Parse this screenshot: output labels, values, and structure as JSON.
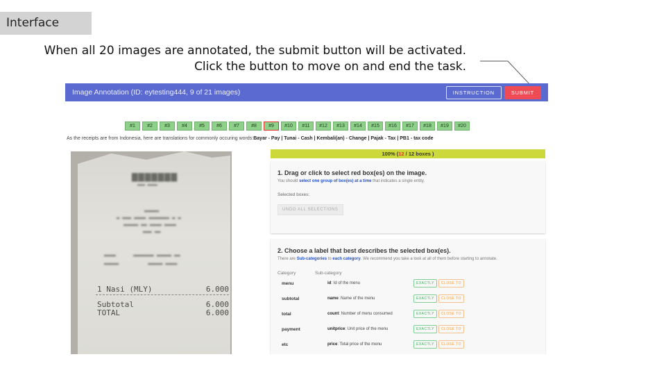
{
  "slide_tag": "Interface",
  "callout": {
    "line1": "When all 20 images are annotated, the submit button will be activated.",
    "line2": "Click the button to move on and end the task."
  },
  "topbar": {
    "title": "Image Annotation (ID: eytesting444, 9 of 21 images)",
    "instruction_label": "INSTRUCTION",
    "submit_label": "SUBMIT"
  },
  "thumbnails": [
    "#1",
    "#2",
    "#3",
    "#4",
    "#5",
    "#6",
    "#7",
    "#8",
    "#9",
    "#10",
    "#11",
    "#12",
    "#13",
    "#14",
    "#15",
    "#16",
    "#17",
    "#18",
    "#19",
    "#20"
  ],
  "active_thumbnail": "#9",
  "translation_note": {
    "prefix": "As the receipts are from Indonesia, here are translations for commonly occuring words:",
    "words": "Bayar - Pay | Tunai - Cash | Kembali(an) - Change | Pajak - Tax | PB1 - tax code"
  },
  "receipt": {
    "lines": [
      {
        "left": "1 Nasi (MLY)",
        "right": "6.000"
      },
      {
        "left": "Subtotal",
        "right": "6.000"
      },
      {
        "left": "TOTAL",
        "right": "6.000"
      }
    ]
  },
  "progress": {
    "percent_text": "100% (",
    "selected": "12",
    "total_text": " / 12 boxes )"
  },
  "step1": {
    "title": "1. Drag or click to select red box(es) on the image.",
    "sub_prefix": "You should ",
    "sub_bold": "select one group of box(es) at a time",
    "sub_suffix": " that indicates a single entity.",
    "selected_label": "Selected boxes:",
    "undo_label": "UNDO ALL SELECTIONS"
  },
  "step2": {
    "title": "2. Choose a label that best describes the selected box(es).",
    "sub_a": "There are ",
    "sub_b": "Sub-categories",
    "sub_c": " to ",
    "sub_d": "each category",
    "sub_e": ". We recommend you take a look at all of them before starting to annotate.",
    "col_category": "Category",
    "col_subcategory": "Sub-category",
    "exact_label": "EXACTLY",
    "close_label": "CLOSE TO",
    "rows": [
      {
        "category": "menu",
        "key": "id",
        "desc": ": Id of the menu"
      },
      {
        "category": "subtotal",
        "key": "name",
        "desc": ": Name of the menu"
      },
      {
        "category": "total",
        "key": "count",
        "desc": ": Number of menu consumed"
      },
      {
        "category": "payment",
        "key": "unitprice",
        "desc": ": Unit price of the menu"
      },
      {
        "category": "etc",
        "key": "price",
        "desc": ": Total price of the menu"
      }
    ]
  }
}
